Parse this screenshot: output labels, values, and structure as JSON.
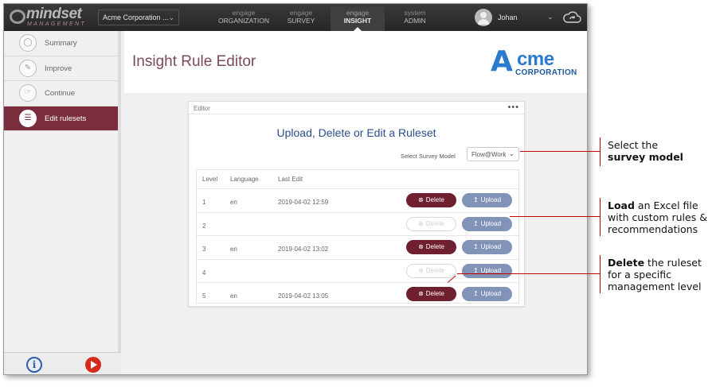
{
  "topbar": {
    "logo_word": "mindset",
    "logo_sub": "MANAGEMENT",
    "company": "Acme Corporation ...",
    "nav": [
      {
        "l1": "engage",
        "l2": "ORGANIZATION"
      },
      {
        "l1": "engage",
        "l2": "SURVEY"
      },
      {
        "l1": "engage",
        "l2": "INSIGHT"
      },
      {
        "l1": "system",
        "l2": "ADMIN"
      }
    ],
    "user_name": "Johan"
  },
  "sidebar": {
    "items": [
      {
        "label": "Summary"
      },
      {
        "label": "Improve"
      },
      {
        "label": "Continue"
      },
      {
        "label": "Edit rulesets"
      }
    ]
  },
  "header": {
    "title": "Insight Rule Editor",
    "brand_a": "A",
    "brand_cme": "cme",
    "brand_corp": "CORPORATION"
  },
  "editor": {
    "card_title": "Editor",
    "menu": "•••",
    "heading": "Upload, Delete or Edit a Ruleset",
    "model_label": "Select Survey Model",
    "model_value": "Flow@Work",
    "columns": [
      "Level",
      "Language",
      "Last Edit"
    ],
    "rows": [
      {
        "level": "1",
        "language": "en",
        "last_edit": "2019-04-02 12:59"
      },
      {
        "level": "2",
        "language": "",
        "last_edit": ""
      },
      {
        "level": "3",
        "language": "en",
        "last_edit": "2019-04-02 13:02"
      },
      {
        "level": "4",
        "language": "",
        "last_edit": ""
      },
      {
        "level": "5",
        "language": "en",
        "last_edit": "2019-04-02 13:05"
      }
    ],
    "delete_label": "Delete",
    "upload_label": "Upload"
  },
  "annotations": {
    "model": {
      "line1": "Select the",
      "bold": "survey model"
    },
    "load": {
      "bold": "Load",
      "rest1": " an Excel file",
      "line2": "with custom rules &",
      "line3": "recommendations"
    },
    "delete": {
      "bold": "Delete",
      "rest1": " the ruleset",
      "line2": "for a specific",
      "line3": "management level"
    }
  },
  "colors": {
    "accent": "#7a2e3d",
    "delete": "#6e1f30",
    "upload": "#8293b8",
    "callout": "#c00000",
    "heading": "#2a4f8a"
  }
}
